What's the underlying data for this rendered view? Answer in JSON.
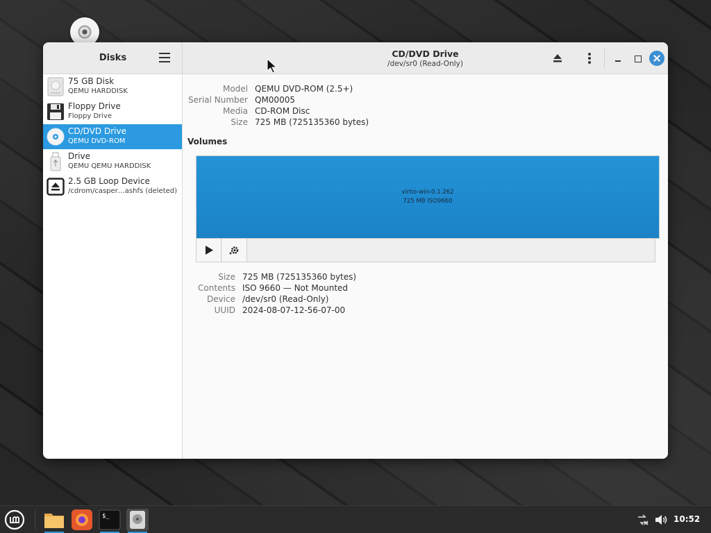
{
  "window": {
    "sidebar_title": "Disks",
    "drive_title": "CD/DVD Drive",
    "drive_subtitle": "/dev/sr0 (Read-Only)"
  },
  "devices": [
    {
      "name": "75 GB Disk",
      "sub": "QEMU HARDDISK",
      "icon": "hard-disk-icon",
      "selected": false
    },
    {
      "name": "Floppy Drive",
      "sub": "Floppy Drive",
      "icon": "floppy-icon",
      "selected": false
    },
    {
      "name": "CD/DVD Drive",
      "sub": "QEMU DVD-ROM",
      "icon": "optical-disc-icon",
      "selected": true
    },
    {
      "name": "Drive",
      "sub": "QEMU QEMU HARDDISK",
      "icon": "usb-drive-icon",
      "selected": false
    },
    {
      "name": "2.5 GB Loop Device",
      "sub": "/cdrom/casper…ashfs (deleted)",
      "icon": "loop-device-icon",
      "selected": false
    }
  ],
  "drive_props": {
    "labels": [
      "Model",
      "Serial Number",
      "Media",
      "Size"
    ],
    "values": [
      "QEMU DVD-ROM (2.5+)",
      "QM00005",
      "CD-ROM Disc",
      "725 MB (725135360 bytes)"
    ]
  },
  "volumes": {
    "heading": "Volumes",
    "volume_name": "virtio-win-0.1.262",
    "volume_info": "725 MB ISO9660"
  },
  "volume_props": {
    "labels": [
      "Size",
      "Contents",
      "Device",
      "UUID"
    ],
    "values": [
      "725 MB (725135360 bytes)",
      "ISO 9660 — Not Mounted",
      "/dev/sr0 (Read-Only)",
      "2024-08-07-12-56-07-00"
    ]
  },
  "taskbar": {
    "clock": "10:52",
    "apps": [
      "menu-icon",
      "files-icon",
      "firefox-icon",
      "terminal-icon",
      "disks-icon"
    ]
  },
  "colors": {
    "accent": "#2b9ae0",
    "volume_fill": "#1f8bd0",
    "close_button": "#3d8fd3"
  }
}
